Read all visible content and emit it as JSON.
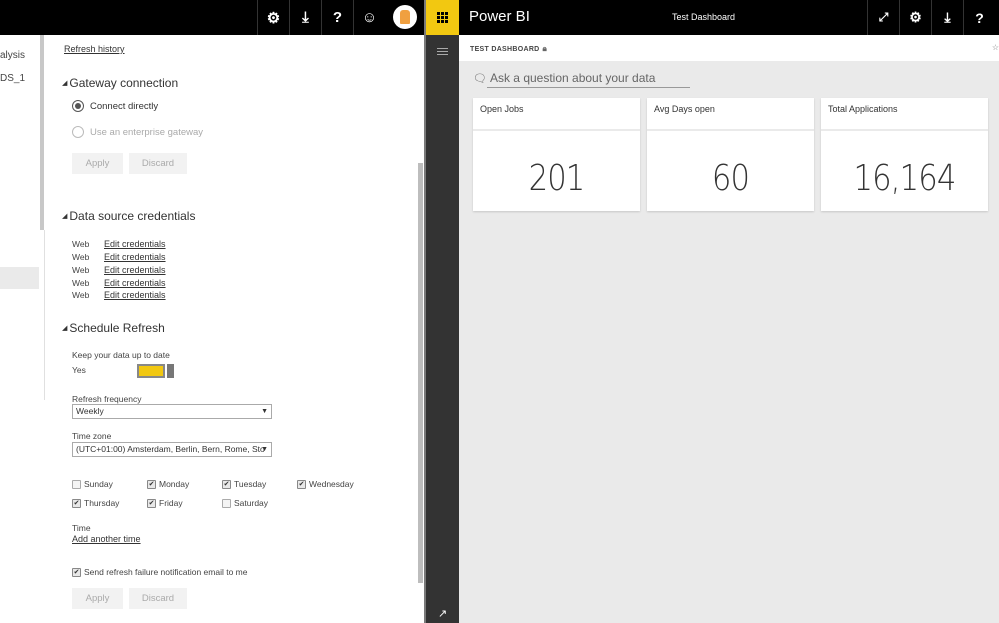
{
  "left_window": {
    "topbar_icons": [
      "gear-icon",
      "download-icon",
      "help-icon",
      "smiley-icon"
    ],
    "nav_items": [
      "alysis",
      "DS_1"
    ],
    "refresh_history_link": "Refresh history",
    "gateway": {
      "title": "Gateway connection",
      "options": [
        {
          "label": "Connect directly",
          "selected": true,
          "enabled": true
        },
        {
          "label": "Use an enterprise gateway",
          "selected": false,
          "enabled": false
        }
      ],
      "apply_label": "Apply",
      "discard_label": "Discard"
    },
    "credentials": {
      "title": "Data source credentials",
      "rows": [
        {
          "type": "Web",
          "link": "Edit credentials"
        },
        {
          "type": "Web",
          "link": "Edit credentials"
        },
        {
          "type": "Web",
          "link": "Edit credentials"
        },
        {
          "type": "Web",
          "link": "Edit credentials"
        },
        {
          "type": "Web",
          "link": "Edit credentials"
        }
      ]
    },
    "schedule": {
      "title": "Schedule Refresh",
      "keep_label": "Keep your data up to date",
      "toggle_value": "Yes",
      "toggle_on": true,
      "frequency_label": "Refresh frequency",
      "frequency_value": "Weekly",
      "timezone_label": "Time zone",
      "timezone_value": "(UTC+01:00) Amsterdam, Berlin, Bern, Rome, Sto",
      "days": [
        {
          "label": "Sunday",
          "checked": false
        },
        {
          "label": "Monday",
          "checked": true
        },
        {
          "label": "Tuesday",
          "checked": true
        },
        {
          "label": "Wednesday",
          "checked": true
        },
        {
          "label": "Thursday",
          "checked": true
        },
        {
          "label": "Friday",
          "checked": true
        },
        {
          "label": "Saturday",
          "checked": false
        }
      ],
      "time_label": "Time",
      "add_time_link": "Add another time",
      "notify_label": "Send refresh failure notification email to me",
      "notify_checked": true,
      "apply_label": "Apply",
      "discard_label": "Discard"
    }
  },
  "right_window": {
    "brand": "Power BI",
    "title": "Test Dashboard",
    "topbar_icons": [
      "fullscreen-icon",
      "gear-icon",
      "download-icon",
      "help-icon"
    ],
    "breadcrumb": "TEST DASHBOARD",
    "qa_placeholder": "Ask a question about your data",
    "tiles": [
      {
        "title": "Open Jobs",
        "value": "201"
      },
      {
        "title": "Avg Days open",
        "value": "60"
      },
      {
        "title": "Total Applications",
        "value": "16,164"
      }
    ],
    "accent_color": "#f2c811"
  }
}
